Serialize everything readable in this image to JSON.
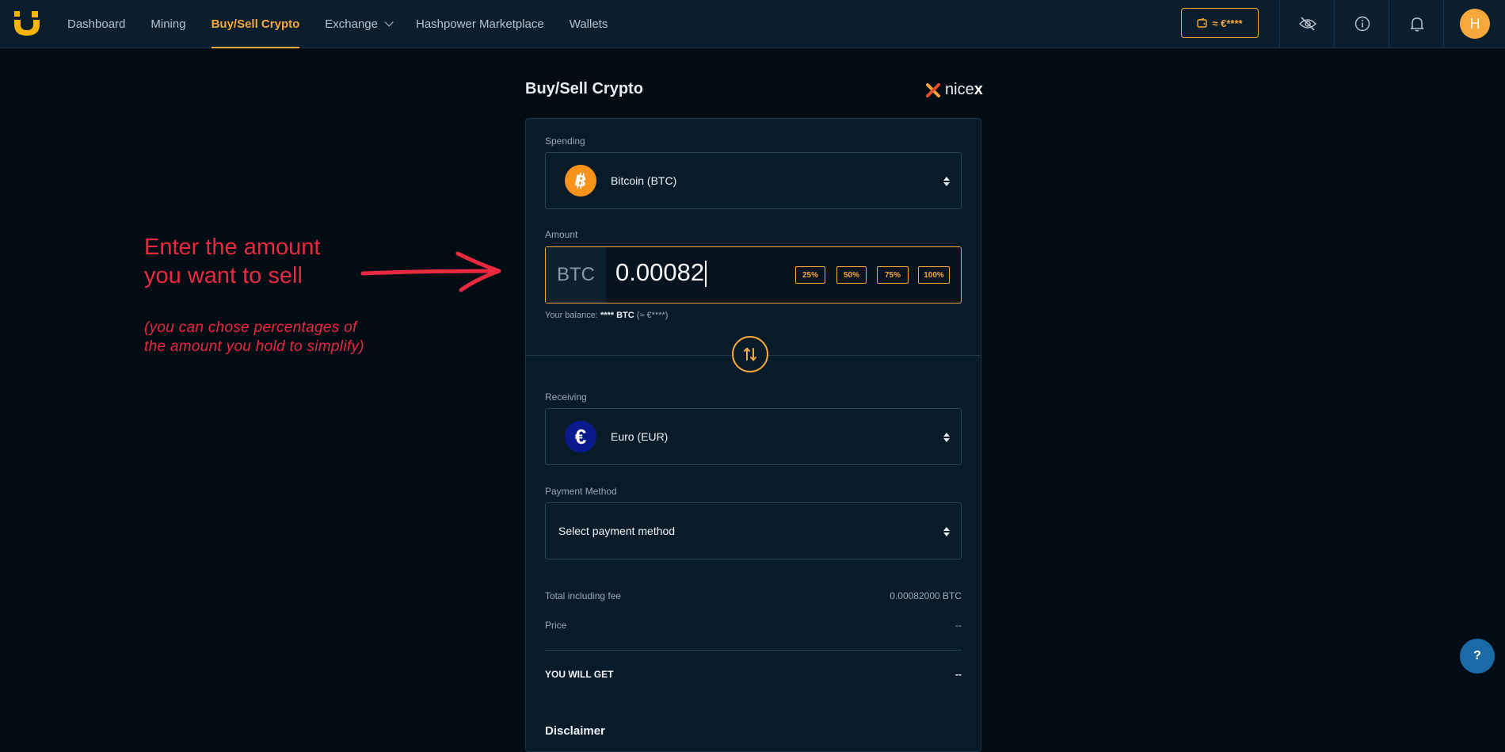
{
  "nav": {
    "links": [
      {
        "label": "Dashboard"
      },
      {
        "label": "Mining"
      },
      {
        "label": "Buy/Sell Crypto",
        "active": true
      },
      {
        "label": "Exchange"
      },
      {
        "label": "Hashpower Marketplace"
      },
      {
        "label": "Wallets"
      }
    ],
    "balance": "≈ €****",
    "avatar_initial": "H"
  },
  "page": {
    "title": "Buy/Sell Crypto",
    "partner_prefix": "nice",
    "partner_suffix": "x"
  },
  "spending": {
    "label": "Spending",
    "selected": "Bitcoin (BTC)"
  },
  "amount": {
    "label": "Amount",
    "unit": "BTC",
    "value": "0.00082",
    "percent_options": [
      "25%",
      "50%",
      "75%",
      "100%"
    ],
    "balance_prefix": "Your balance:",
    "balance_value": "**** BTC",
    "balance_fiat": "(≈ €****)"
  },
  "receiving": {
    "label": "Receiving",
    "selected": "Euro (EUR)"
  },
  "payment": {
    "label": "Payment Method",
    "placeholder": "Select payment method"
  },
  "summary": {
    "total_label": "Total including fee",
    "total_value": "0.00082000 BTC",
    "price_label": "Price",
    "price_value": "--",
    "get_label": "YOU WILL GET",
    "get_value": "--"
  },
  "disclaimer": "Disclaimer",
  "annotation": {
    "line1": "Enter the amount",
    "line2": "you want to sell",
    "sub1": "(you can chose percentages of",
    "sub2": "the amount you hold to simplify)"
  },
  "help_label": "?",
  "colors": {
    "accent": "#f7a83b",
    "annotation": "#e8293f",
    "background": "#020c14",
    "card": "#081b29"
  }
}
